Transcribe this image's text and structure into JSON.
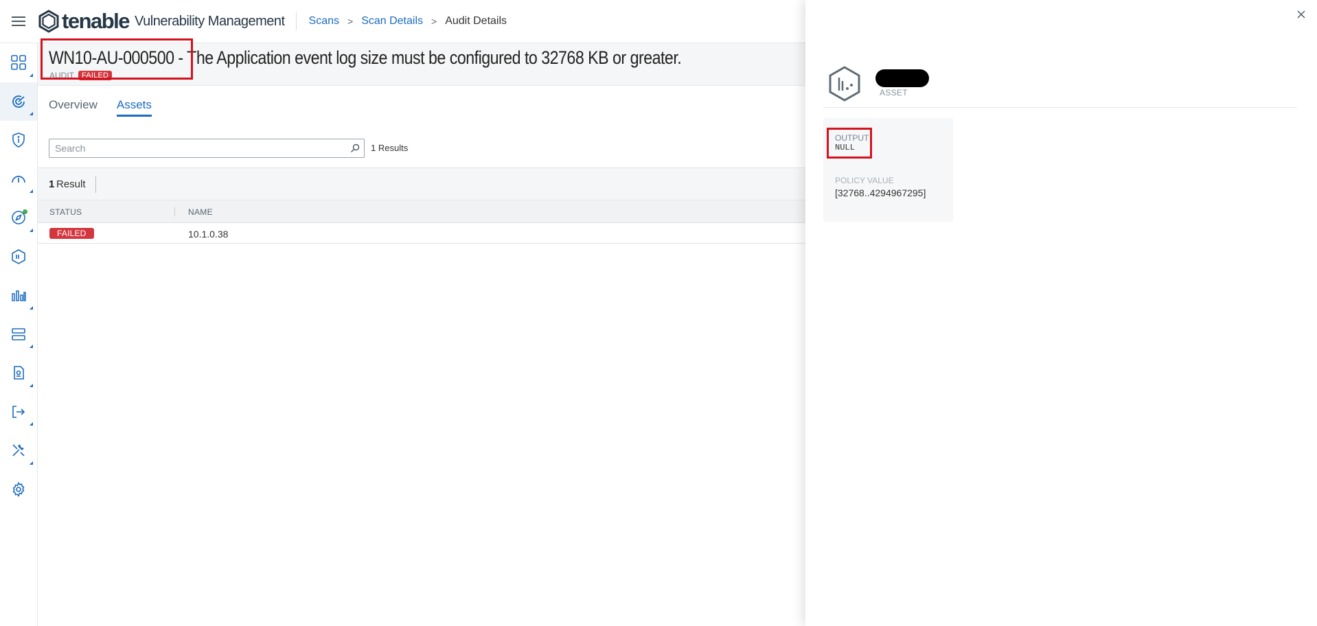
{
  "header": {
    "logo_word": "tenable",
    "product": "Vulnerability Management",
    "breadcrumbs": [
      {
        "label": "Scans"
      },
      {
        "label": "Scan Details"
      },
      {
        "label": "Audit Details"
      }
    ],
    "breadcrumb_separator": ">"
  },
  "leftnav": {
    "items": [
      {
        "icon": "dashboard-grid-icon"
      },
      {
        "icon": "scans-radar-icon",
        "active": true
      },
      {
        "icon": "shield-info-icon"
      },
      {
        "icon": "speedometer-icon"
      },
      {
        "icon": "compass-icon"
      },
      {
        "icon": "hexagon-asset-icon"
      },
      {
        "icon": "analytics-chart-icon"
      },
      {
        "icon": "server-stack-icon"
      },
      {
        "icon": "report-document-icon"
      },
      {
        "icon": "export-arrow-icon"
      },
      {
        "icon": "tools-icon"
      },
      {
        "icon": "settings-gear-icon"
      }
    ]
  },
  "audit": {
    "title": "WN10-AU-000500 - The Application event log size must be configured to 32768 KB or greater.",
    "type_label": "AUDIT",
    "status": "FAILED"
  },
  "tabs": [
    {
      "label": "Overview",
      "active": false
    },
    {
      "label": "Assets",
      "active": true
    }
  ],
  "search": {
    "placeholder": "Search",
    "value": "",
    "results_text": "1 Results"
  },
  "results_bar": {
    "count": "1",
    "label": "Result"
  },
  "table": {
    "columns": [
      "STATUS",
      "NAME"
    ],
    "rows": [
      {
        "status": "FAILED",
        "name": "10.1.0.38"
      }
    ]
  },
  "panel": {
    "asset_label": "ASSET",
    "output_label": "OUTPUT",
    "output_value": "NULL",
    "policy_value_label": "POLICY VALUE",
    "policy_value": "[32768..4294967295]"
  },
  "colors": {
    "brand_navy": "#263746",
    "link_blue": "#1b6bbf",
    "failed_red": "#d3363e",
    "highlight_red": "#d4121e"
  }
}
